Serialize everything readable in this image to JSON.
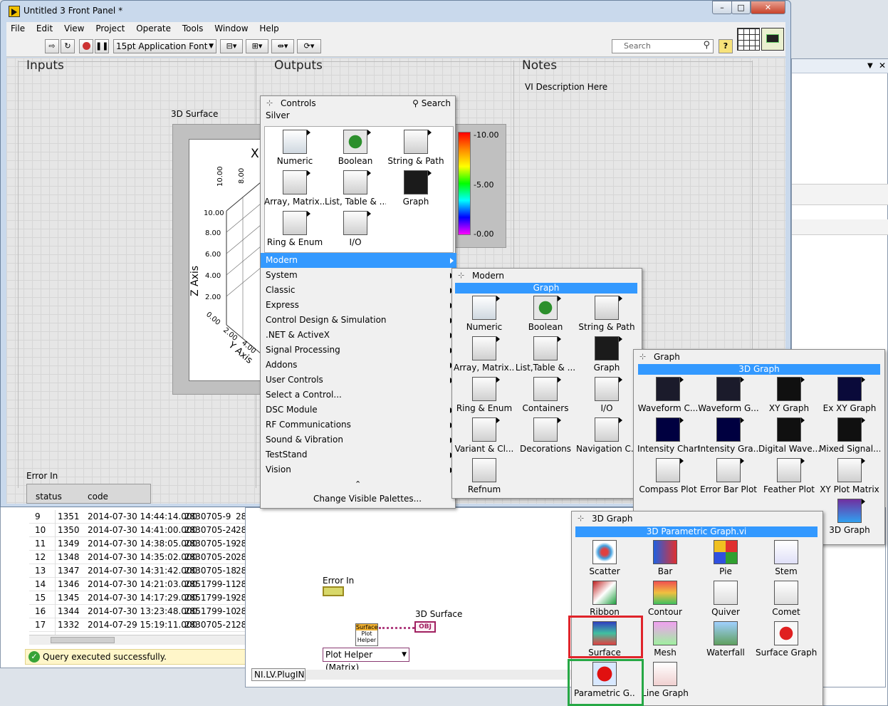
{
  "window": {
    "title": "Untitled 3 Front Panel *",
    "minimize": "–",
    "maximize": "□",
    "close": "✕"
  },
  "menu": [
    "File",
    "Edit",
    "View",
    "Project",
    "Operate",
    "Tools",
    "Window",
    "Help"
  ],
  "toolbar": {
    "font_select": "15pt Application Font",
    "search_placeholder": "Search",
    "help": "?"
  },
  "sections": {
    "inputs": "Inputs",
    "outputs": "Outputs",
    "notes": "Notes",
    "notes_text": "VI Description Here"
  },
  "graph": {
    "label": "3D Surface",
    "x_axis_letter": "X",
    "z_axis_title": "Z Axis",
    "y_axis_title": "Y Axis",
    "z_ticks": [
      "10.00",
      "8.00",
      "6.00",
      "4.00",
      "2.00",
      "0.00"
    ],
    "x_ticks": [
      "10.00",
      "8.00"
    ],
    "y_ticks": [
      "2.00",
      "4.00"
    ],
    "color_ticks": [
      "10.00",
      "5.00",
      "0.00"
    ]
  },
  "error_in": {
    "label": "Error In",
    "status": "status",
    "code": "code"
  },
  "controls_palette": {
    "title": "Controls",
    "search": "Search",
    "category": "Silver",
    "items": [
      "Numeric",
      "Boolean",
      "String & Path",
      "Array, Matrix...",
      "List, Table & ...",
      "Graph",
      "Ring & Enum",
      "I/O"
    ],
    "menu": [
      "Modern",
      "System",
      "Classic",
      "Express",
      "Control Design & Simulation",
      ".NET & ActiveX",
      "Signal Processing",
      "Addons",
      "User Controls",
      "Select a Control...",
      "DSC Module",
      "RF Communications",
      "Sound & Vibration",
      "TestStand",
      "Vision"
    ],
    "menu_arrows": [
      true,
      true,
      true,
      true,
      true,
      true,
      true,
      true,
      true,
      false,
      true,
      true,
      true,
      true,
      true
    ],
    "change_palettes": "Change Visible Palettes...",
    "collapse_glyph": "⌃"
  },
  "modern_palette": {
    "title": "Modern",
    "bar": "Graph",
    "items": [
      "Numeric",
      "Boolean",
      "String & Path",
      "Array, Matrix...",
      "List,Table & ...",
      "Graph",
      "Ring & Enum",
      "Containers",
      "I/O",
      "Variant & Cl...",
      "Decorations",
      "Navigation C...",
      "Refnum"
    ]
  },
  "graph_palette": {
    "title": "Graph",
    "bar": "3D Graph",
    "items": [
      "Waveform C...",
      "Waveform G...",
      "XY Graph",
      "Ex XY Graph",
      "Intensity Chart",
      "Intensity Gra...",
      "Digital Wave...",
      "Mixed Signal...",
      "Compass Plot",
      "Error Bar Plot",
      "Feather Plot",
      "XY Plot Matrix",
      "3D Graph"
    ]
  },
  "graph3d_palette": {
    "title": "3D Graph",
    "bar": "3D Parametric Graph.vi",
    "items": [
      "Scatter",
      "Bar",
      "Pie",
      "Stem",
      "Ribbon",
      "Contour",
      "Quiver",
      "Comet",
      "Surface",
      "Mesh",
      "Waterfall",
      "Surface Graph",
      "Parametric G...",
      "Line Graph"
    ]
  },
  "table": {
    "rows": [
      [
        "9",
        "1351",
        "2014-07-30 14:44:14.000",
        "2830705-9",
        "28"
      ],
      [
        "10",
        "1350",
        "2014-07-30 14:41:00.000",
        "2830705-24",
        "28"
      ],
      [
        "11",
        "1349",
        "2014-07-30 14:38:05.000",
        "2830705-19",
        "28"
      ],
      [
        "12",
        "1348",
        "2014-07-30 14:35:02.000",
        "2830705-20",
        "28"
      ],
      [
        "13",
        "1347",
        "2014-07-30 14:31:42.000",
        "2830705-18",
        "28"
      ],
      [
        "14",
        "1346",
        "2014-07-30 14:21:03.000",
        "2851799-11",
        "28"
      ],
      [
        "15",
        "1345",
        "2014-07-30 14:17:29.000",
        "2851799-19",
        "28"
      ],
      [
        "16",
        "1344",
        "2014-07-30 13:23:48.000",
        "2851799-10",
        "28"
      ],
      [
        "17",
        "1332",
        "2014-07-29 15:19:11.000",
        "2830705-21",
        "28"
      ]
    ],
    "status": "Query executed successfully."
  },
  "diagram": {
    "error_in": "Error In",
    "surface_label": "3D Surface",
    "obj": "OBJ",
    "helper_top": "Surface",
    "helper_bottom": "Plot Helper",
    "plot_helper_select": "Plot Helper (Matrix)",
    "plugin_tab": "NI.LV.PlugIN"
  }
}
